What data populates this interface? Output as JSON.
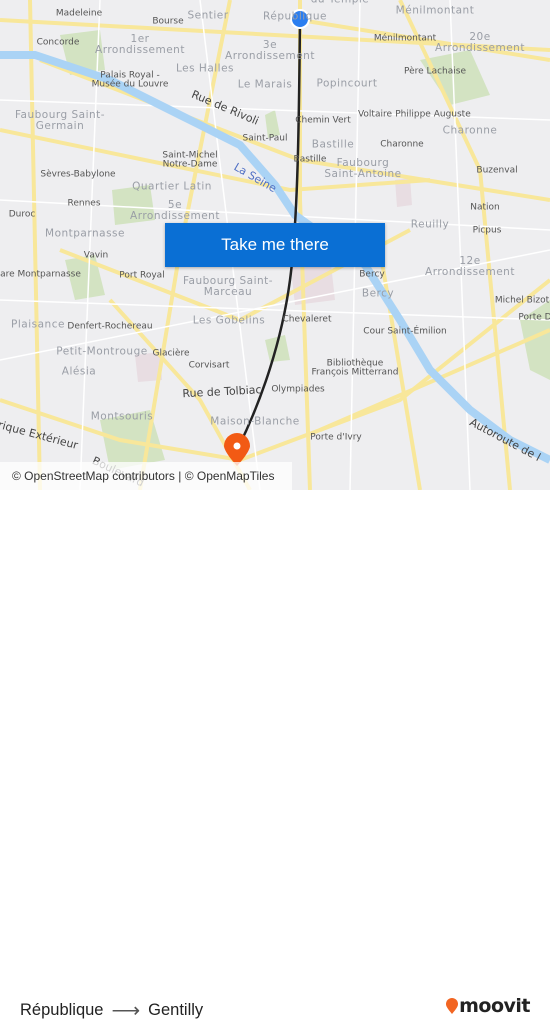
{
  "map": {
    "labels": [
      {
        "text": "Madeleine",
        "cls": ""
      },
      {
        "text": "Bourse",
        "cls": ""
      },
      {
        "text": "Sentier",
        "cls": "district"
      },
      {
        "text": "République",
        "cls": "district"
      },
      {
        "text": "du Temple",
        "cls": "district"
      },
      {
        "text": "Ménilmontant",
        "cls": "district"
      },
      {
        "text": "Concorde",
        "cls": ""
      },
      {
        "text": "1er\nArrondissement",
        "cls": "district"
      },
      {
        "text": "3e\nArrondissement",
        "cls": "district"
      },
      {
        "text": "Ménilmontant",
        "cls": ""
      },
      {
        "text": "20e\nArrondissement",
        "cls": "district"
      },
      {
        "text": "Les Halles",
        "cls": "district"
      },
      {
        "text": "Palais Royal -\nMusée du Louvre",
        "cls": ""
      },
      {
        "text": "Le Marais",
        "cls": "district"
      },
      {
        "text": "Popincourt",
        "cls": "district"
      },
      {
        "text": "Père Lachaise",
        "cls": ""
      },
      {
        "text": "Rue de Rivoli",
        "cls": "street"
      },
      {
        "text": "Faubourg Saint-\nGermain",
        "cls": "district"
      },
      {
        "text": "Chemin Vert",
        "cls": ""
      },
      {
        "text": "Voltaire",
        "cls": ""
      },
      {
        "text": "Philippe Auguste",
        "cls": ""
      },
      {
        "text": "Charonne",
        "cls": "district"
      },
      {
        "text": "Saint-Paul",
        "cls": ""
      },
      {
        "text": "Bastille",
        "cls": "district"
      },
      {
        "text": "Charonne",
        "cls": ""
      },
      {
        "text": "Saint-Michel\nNotre-Dame",
        "cls": ""
      },
      {
        "text": "Bastille",
        "cls": ""
      },
      {
        "text": "Faubourg\nSaint-Antoine",
        "cls": "district"
      },
      {
        "text": "Sèvres-Babylone",
        "cls": ""
      },
      {
        "text": "La Seine",
        "cls": "water"
      },
      {
        "text": "Buzenval",
        "cls": ""
      },
      {
        "text": "Quartier Latin",
        "cls": "district"
      },
      {
        "text": "Rennes",
        "cls": ""
      },
      {
        "text": "5e\nArrondissement",
        "cls": "district"
      },
      {
        "text": "Nation",
        "cls": ""
      },
      {
        "text": "Duroc",
        "cls": ""
      },
      {
        "text": "Reuilly",
        "cls": "district"
      },
      {
        "text": "Picpus",
        "cls": ""
      },
      {
        "text": "Montparnasse",
        "cls": "district"
      },
      {
        "text": "Vavin",
        "cls": ""
      },
      {
        "text": "12e\nArrondissement",
        "cls": "district"
      },
      {
        "text": "Gare Montparnasse",
        "cls": ""
      },
      {
        "text": "Port Royal",
        "cls": ""
      },
      {
        "text": "Faubourg Saint-\nMarceau",
        "cls": "district"
      },
      {
        "text": "Bercy",
        "cls": ""
      },
      {
        "text": "Bercy",
        "cls": "district"
      },
      {
        "text": "Michel Bizot",
        "cls": ""
      },
      {
        "text": "Porte D",
        "cls": ""
      },
      {
        "text": "Plaisance",
        "cls": "district"
      },
      {
        "text": "Denfert-Rochereau",
        "cls": ""
      },
      {
        "text": "Les Gobelins",
        "cls": "district"
      },
      {
        "text": "Chevaleret",
        "cls": ""
      },
      {
        "text": "Cour Saint-Émilion",
        "cls": ""
      },
      {
        "text": "Petit-Montrouge",
        "cls": "district"
      },
      {
        "text": "Glacière",
        "cls": ""
      },
      {
        "text": "Corvisart",
        "cls": ""
      },
      {
        "text": "Bibliothèque\nFrançois Mitterrand",
        "cls": ""
      },
      {
        "text": "Alésia",
        "cls": "district"
      },
      {
        "text": "Rue de Tolbiac",
        "cls": "street"
      },
      {
        "text": "Olympiades",
        "cls": ""
      },
      {
        "text": "Montsouris",
        "cls": "district"
      },
      {
        "text": "Maison-Blanche",
        "cls": "district"
      },
      {
        "text": "Porte d'Ivry",
        "cls": ""
      },
      {
        "text": "Autoroute de l",
        "cls": "street"
      },
      {
        "text": "Boulevard",
        "cls": "street"
      },
      {
        "text": "Périphérique Extérieur",
        "cls": "street"
      }
    ],
    "origin_marker_color": "#2b7ef0",
    "destination_marker_color": "#f25a14",
    "route_color": "#222222"
  },
  "cta": {
    "label": "Take me there"
  },
  "attribution": "© OpenStreetMap contributors | © OpenMapTiles",
  "route": {
    "from": "République",
    "to": "Gentilly",
    "arrow": "⟶"
  },
  "brand": {
    "name": "moovit",
    "color": "#f26522"
  }
}
